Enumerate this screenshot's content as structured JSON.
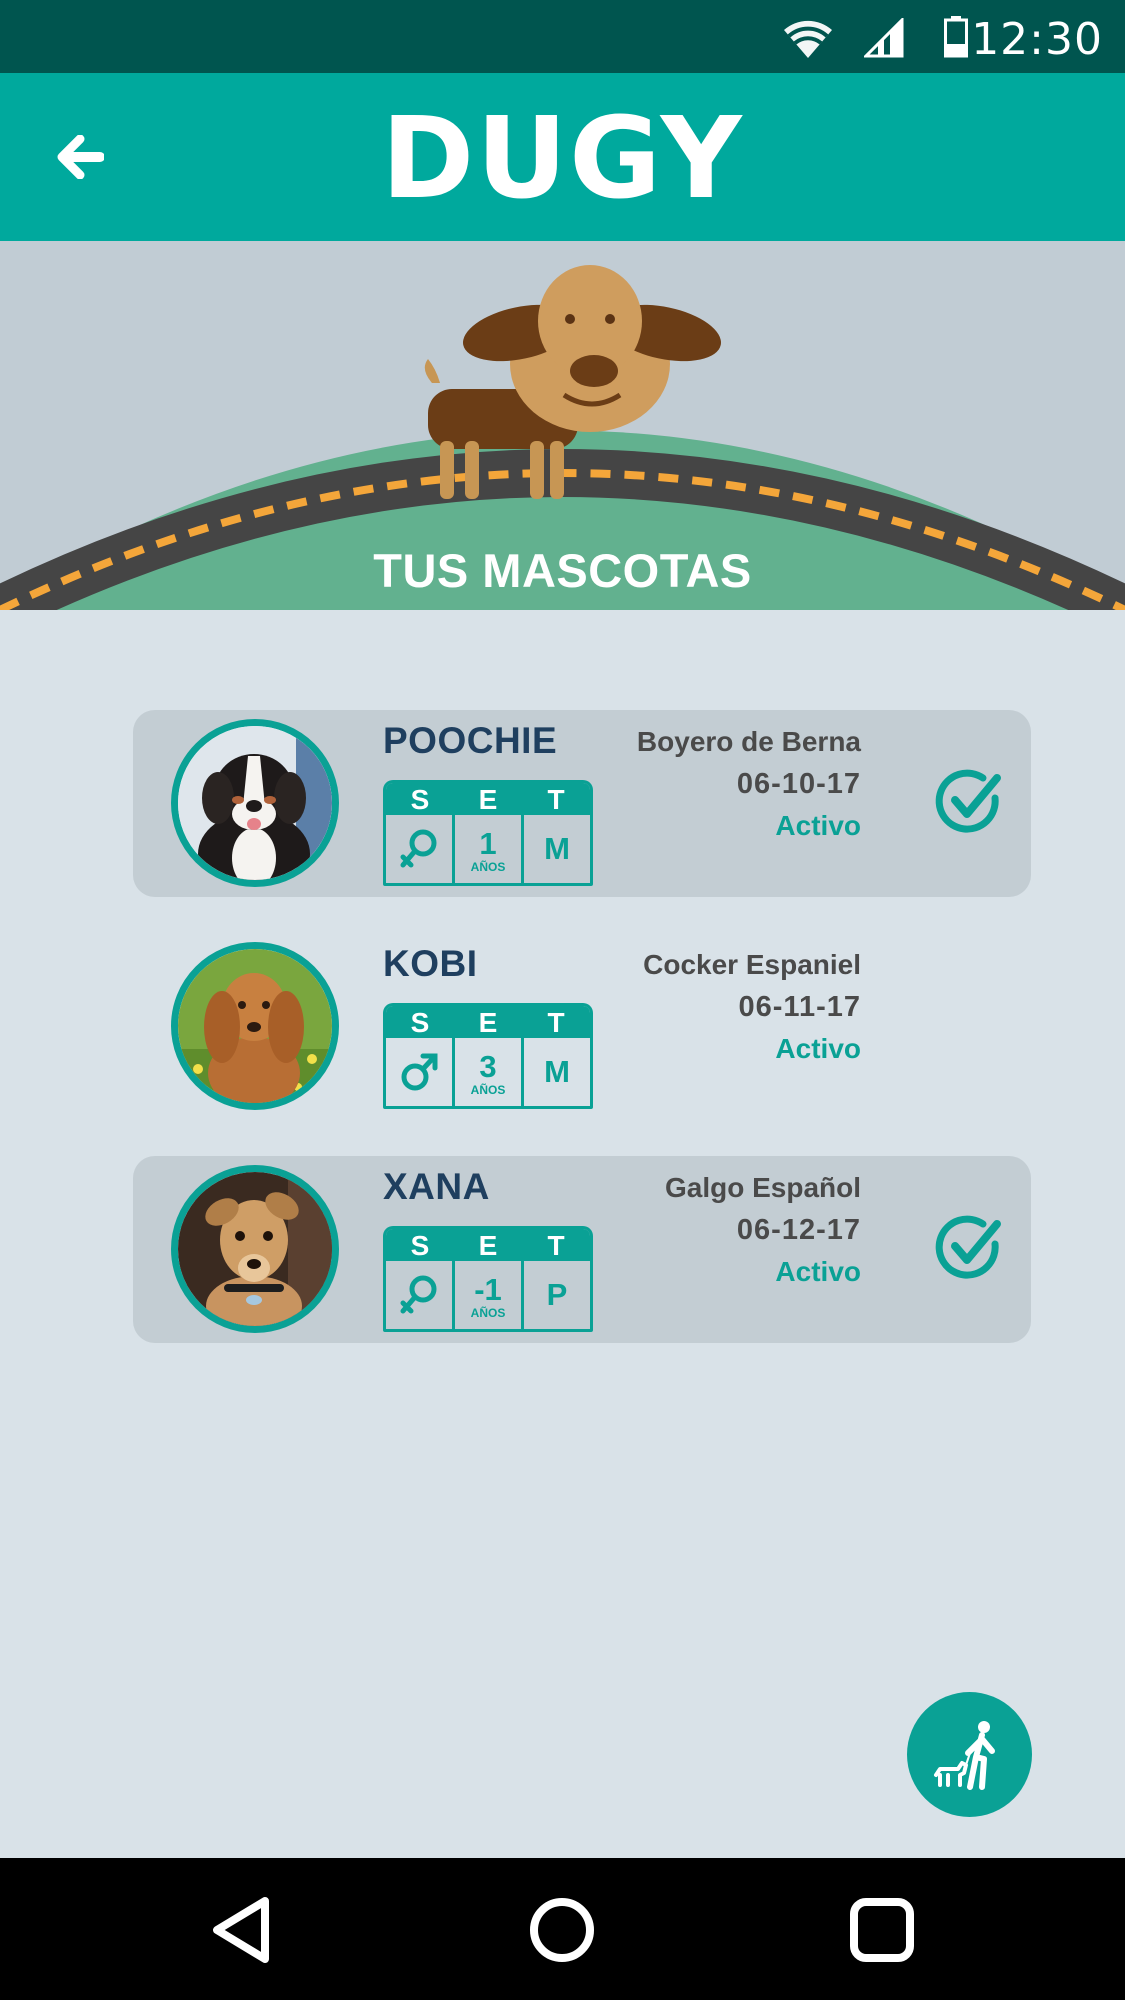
{
  "status_bar": {
    "time": "12:30",
    "icons": [
      "wifi-icon",
      "signal-icon",
      "battery-icon"
    ]
  },
  "app_bar": {
    "title": "DUGY",
    "back_icon": "arrow-back-icon"
  },
  "hero": {
    "title": "TUS MASCOTAS"
  },
  "set_headers": [
    "S",
    "E",
    "T"
  ],
  "pets": [
    {
      "name": "POOCHIE",
      "sex_icon": "female-icon",
      "age": "1",
      "age_unit": "AÑOS",
      "size": "M",
      "breed": "Boyero de Berna",
      "date": "06-10-17",
      "status": "Activo",
      "selected": true
    },
    {
      "name": "KOBI",
      "sex_icon": "male-icon",
      "age": "3",
      "age_unit": "AÑOS",
      "size": "M",
      "breed": "Cocker Espaniel",
      "date": "06-11-17",
      "status": "Activo",
      "selected": false
    },
    {
      "name": "XANA",
      "sex_icon": "female-icon",
      "age": "-1",
      "age_unit": "AÑOS",
      "size": "P",
      "breed": "Galgo Español",
      "date": "06-12-17",
      "status": "Activo",
      "selected": true
    }
  ],
  "fab": {
    "icon": "dog-walker-icon"
  },
  "nav": {
    "icons": [
      "nav-back-icon",
      "nav-home-icon",
      "nav-recents-icon"
    ]
  },
  "colors": {
    "status_bar": "#00554f",
    "primary": "#00a99d",
    "accent": "#0aa195",
    "background": "#d9e2e8",
    "selected_card": "#c3cdd3",
    "name_text": "#1f3f5f"
  }
}
